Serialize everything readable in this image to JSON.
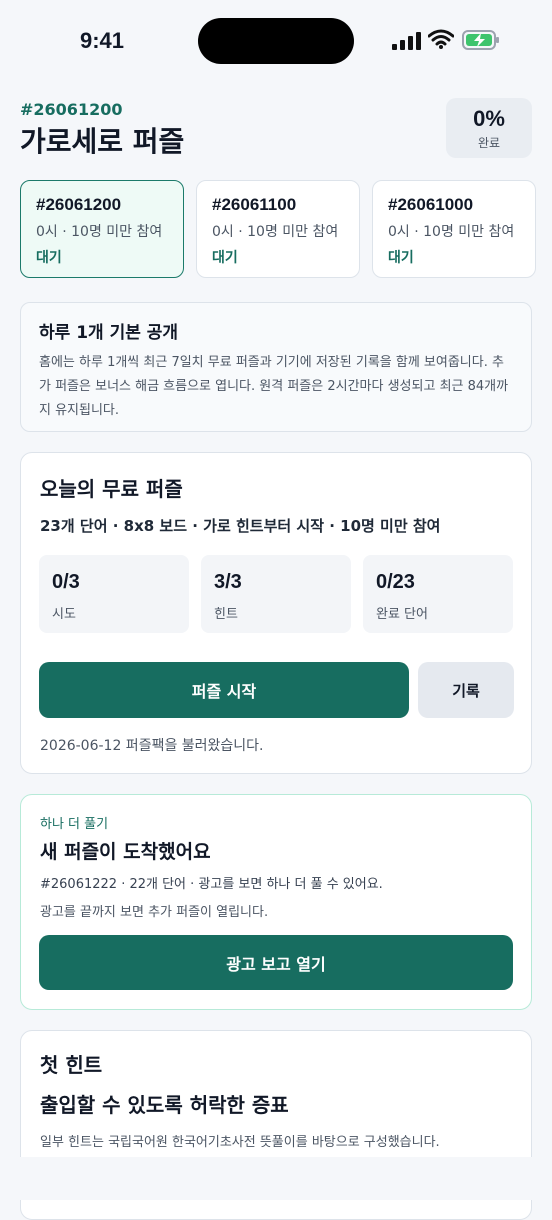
{
  "status_bar": {
    "time": "9:41",
    "icons": [
      "signal-icon",
      "wifi-icon",
      "battery-charging-icon"
    ]
  },
  "header": {
    "puzzle_id": "#26061200",
    "title": "가로세로 퍼즐",
    "progress_value": "0%",
    "progress_label": "완료"
  },
  "puzzle_cards": [
    {
      "id": "#26061200",
      "meta": "0시 · 10명 미만 참여",
      "status": "대기"
    },
    {
      "id": "#26061100",
      "meta": "0시 · 10명 미만 참여",
      "status": "대기"
    },
    {
      "id": "#26061000",
      "meta": "0시 · 10명 미만 참여",
      "status": "대기"
    }
  ],
  "info": {
    "title": "하루 1개 기본 공개",
    "body": "홈에는 하루 1개씩 최근 7일치 무료 퍼즐과 기기에 저장된 기록을 함께 보여줍니다. 추가 퍼즐은 보너스 해금 흐름으로 엽니다. 원격 퍼즐은 2시간마다 생성되고 최근 84개까지 유지됩니다."
  },
  "today": {
    "title": "오늘의 무료 퍼즐",
    "meta": "23개 단어 · 8x8 보드 · 가로 힌트부터 시작 · 10명 미만 참여",
    "stats": [
      {
        "value": "0/3",
        "label": "시도"
      },
      {
        "value": "3/3",
        "label": "힌트"
      },
      {
        "value": "0/23",
        "label": "완료 단어"
      }
    ],
    "start_label": "퍼즐 시작",
    "history_label": "기록",
    "load_status": "2026-06-12 퍼즐팩을 불러왔습니다."
  },
  "bonus": {
    "eyebrow": "하나 더 풀기",
    "title": "새 퍼즐이 도착했어요",
    "meta": "#26061222 · 22개 단어 · 광고를 보면 하나 더 풀 수 있어요.",
    "note": "광고를 끝까지 보면 추가 퍼즐이 열립니다.",
    "button_label": "광고 보고 열기"
  },
  "hint": {
    "title": "첫 힌트",
    "text": "출입할 수 있도록 허락한 증표",
    "source": "일부 힌트는 국립국어원 한국어기초사전 뜻풀이를 바탕으로 구성했습니다."
  },
  "colors": {
    "accent": "#176d60",
    "background": "#f5f7fa",
    "card_border": "#dde3ea",
    "bonus_border": "#b7ead8"
  }
}
